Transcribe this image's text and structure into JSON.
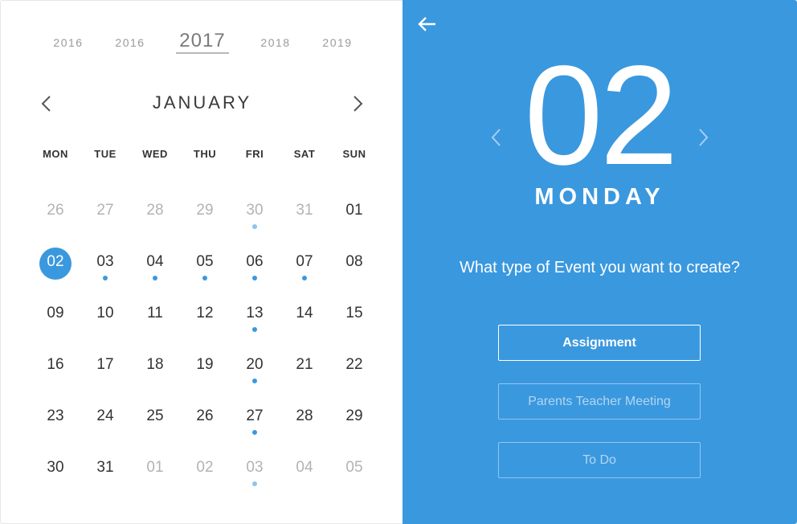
{
  "years": [
    {
      "label": "2016",
      "active": false
    },
    {
      "label": "2016",
      "active": false
    },
    {
      "label": "2017",
      "active": true
    },
    {
      "label": "2018",
      "active": false
    },
    {
      "label": "2019",
      "active": false
    }
  ],
  "month": {
    "name": "JANUARY"
  },
  "weekdays": [
    "MON",
    "TUE",
    "WED",
    "THU",
    "FRI",
    "SAT",
    "SUN"
  ],
  "weeks": [
    [
      {
        "n": "26",
        "muted": true
      },
      {
        "n": "27",
        "muted": true
      },
      {
        "n": "28",
        "muted": true
      },
      {
        "n": "29",
        "muted": true
      },
      {
        "n": "30",
        "muted": true,
        "dot": true
      },
      {
        "n": "31",
        "muted": true
      },
      {
        "n": "01"
      }
    ],
    [
      {
        "n": "02",
        "selected": true
      },
      {
        "n": "03",
        "dot": true
      },
      {
        "n": "04",
        "dot": true
      },
      {
        "n": "05",
        "dot": true
      },
      {
        "n": "06",
        "dot": true
      },
      {
        "n": "07",
        "dot": true
      },
      {
        "n": "08"
      }
    ],
    [
      {
        "n": "09"
      },
      {
        "n": "10"
      },
      {
        "n": "11"
      },
      {
        "n": "12"
      },
      {
        "n": "13",
        "dot": true
      },
      {
        "n": "14"
      },
      {
        "n": "15"
      }
    ],
    [
      {
        "n": "16"
      },
      {
        "n": "17"
      },
      {
        "n": "18"
      },
      {
        "n": "19"
      },
      {
        "n": "20",
        "dot": true
      },
      {
        "n": "21"
      },
      {
        "n": "22"
      }
    ],
    [
      {
        "n": "23"
      },
      {
        "n": "24"
      },
      {
        "n": "25"
      },
      {
        "n": "26"
      },
      {
        "n": "27",
        "dot": true
      },
      {
        "n": "28"
      },
      {
        "n": "29"
      }
    ],
    [
      {
        "n": "30"
      },
      {
        "n": "31"
      },
      {
        "n": "01",
        "muted": true
      },
      {
        "n": "02",
        "muted": true
      },
      {
        "n": "03",
        "muted": true,
        "dot": true
      },
      {
        "n": "04",
        "muted": true
      },
      {
        "n": "05",
        "muted": true
      }
    ]
  ],
  "detail": {
    "date": "02",
    "weekday": "MONDAY",
    "question": "What type of Event you want to create?",
    "options": {
      "assignment": "Assignment",
      "ptm": "Parents Teacher Meeting",
      "todo": "To Do"
    }
  },
  "colors": {
    "accent": "#3a98de",
    "muted_text": "#b3b3b3"
  },
  "icons": {
    "back": "arrow-left-icon",
    "prev": "chevron-left-icon",
    "next": "chevron-right-icon"
  }
}
